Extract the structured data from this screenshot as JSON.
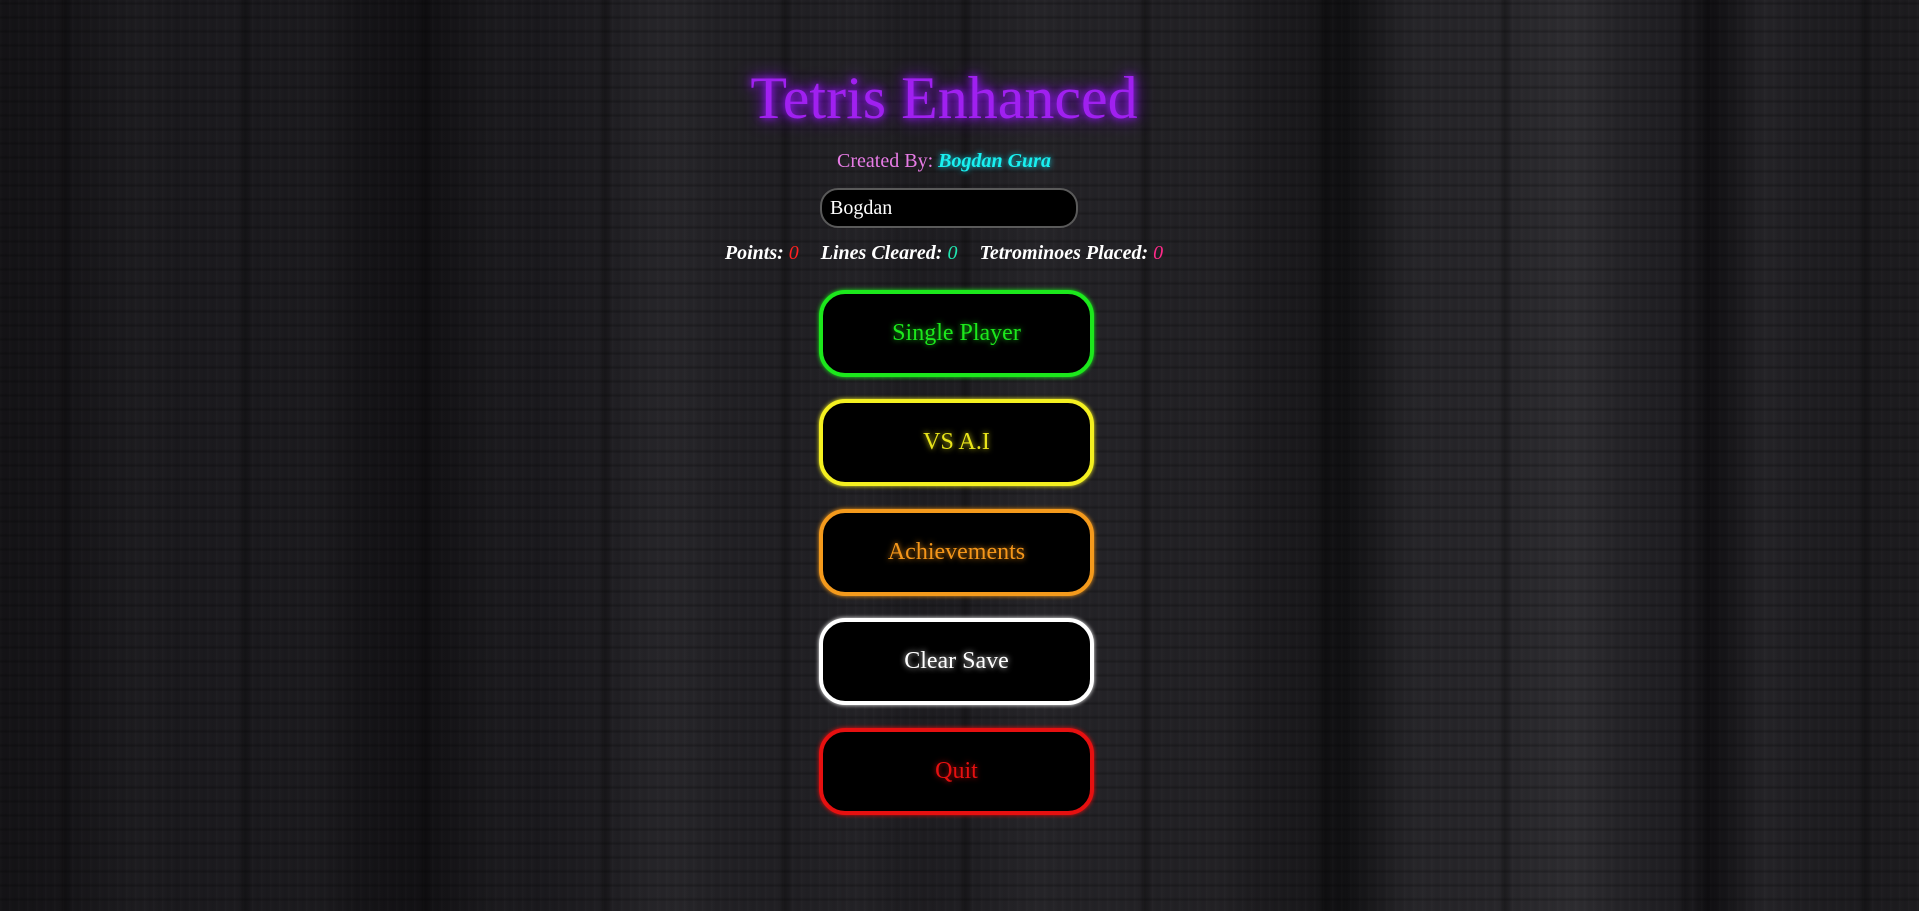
{
  "title": "Tetris Enhanced",
  "credit": {
    "label": "Created By:",
    "author": "Bogdan Gura"
  },
  "player_name_input": {
    "value": "Bogdan"
  },
  "stats": {
    "points_label": "Points:",
    "points_value": "0",
    "lines_label": "Lines Cleared:",
    "lines_value": "0",
    "tetrominoes_label": "Tetrominoes Placed:",
    "tetrominoes_value": "0"
  },
  "menu": {
    "single_player": "Single Player",
    "vs_ai": "VS A.I",
    "achievements": "Achievements",
    "clear_save": "Clear Save",
    "quit": "Quit"
  },
  "colors": {
    "title": "#a020f0",
    "author": "#19f0f0",
    "single_player": "#1ce81c",
    "vs_ai": "#f4f020",
    "achievements": "#f49a1c",
    "clear_save": "#ffffff",
    "quit": "#e61010"
  }
}
